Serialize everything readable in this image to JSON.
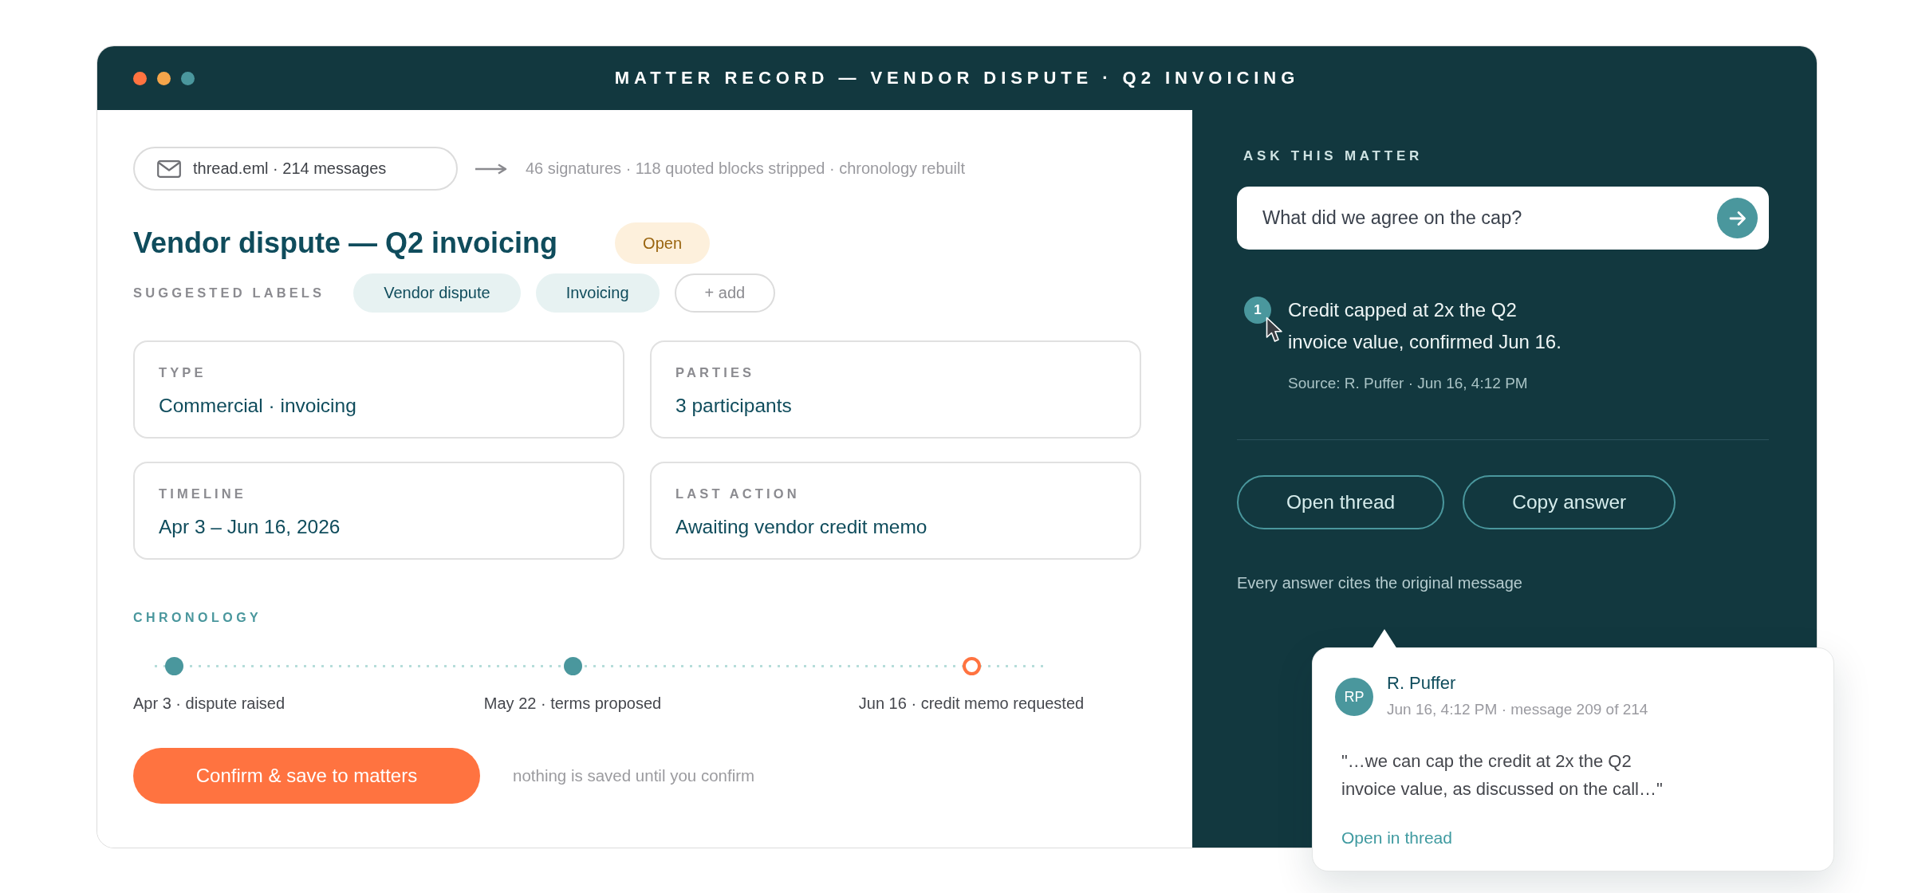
{
  "window": {
    "title": "MATTER RECORD — VENDOR DISPUTE · Q2 INVOICING"
  },
  "source": {
    "file": "thread.eml · 214 messages",
    "summary": "46 signatures · 118 quoted blocks stripped · chronology rebuilt"
  },
  "matter": {
    "title": "Vendor dispute — Q2 invoicing",
    "status": "Open"
  },
  "suggested_labels": {
    "heading": "SUGGESTED LABELS",
    "chips": [
      {
        "label": "Vendor dispute",
        "kind": "label"
      },
      {
        "label": "Invoicing",
        "kind": "label"
      },
      {
        "label": "+ add",
        "kind": "add"
      }
    ]
  },
  "fields": [
    {
      "label": "TYPE",
      "value": "Commercial · invoicing"
    },
    {
      "label": "PARTIES",
      "value": "3 participants"
    },
    {
      "label": "TIMELINE",
      "value": "Apr 3 – Jun 16, 2026"
    },
    {
      "label": "LAST ACTION",
      "value": "Awaiting vendor credit memo"
    }
  ],
  "chronology": {
    "heading": "CHRONOLOGY",
    "events": [
      {
        "label": "Apr 3 · dispute raised",
        "pending": false
      },
      {
        "label": "May 22 · terms proposed",
        "pending": false
      },
      {
        "label": "Jun 16 · credit memo requested",
        "pending": true
      }
    ]
  },
  "actions": {
    "confirm": "Confirm & save to matters",
    "note": "nothing is saved until you confirm"
  },
  "ask": {
    "heading": "ASK THIS MATTER",
    "query": "What did we agree on the cap?",
    "answer": {
      "citation": "1",
      "text": "Credit capped at 2x the Q2 invoice value, confirmed Jun 16.",
      "source": "Source: R. Puffer · Jun 16, 4:12 PM"
    },
    "buttons": [
      "Open thread",
      "Copy answer"
    ],
    "footnote": "Every answer cites the original message"
  },
  "citation_popover": {
    "initials": "RP",
    "author": "R. Puffer",
    "meta": "Jun 16, 4:12 PM · message 209 of 214",
    "quote": "\"…we can cap the credit at 2x the Q2 invoice value, as discussed on the call…\"",
    "link": "Open in thread"
  }
}
